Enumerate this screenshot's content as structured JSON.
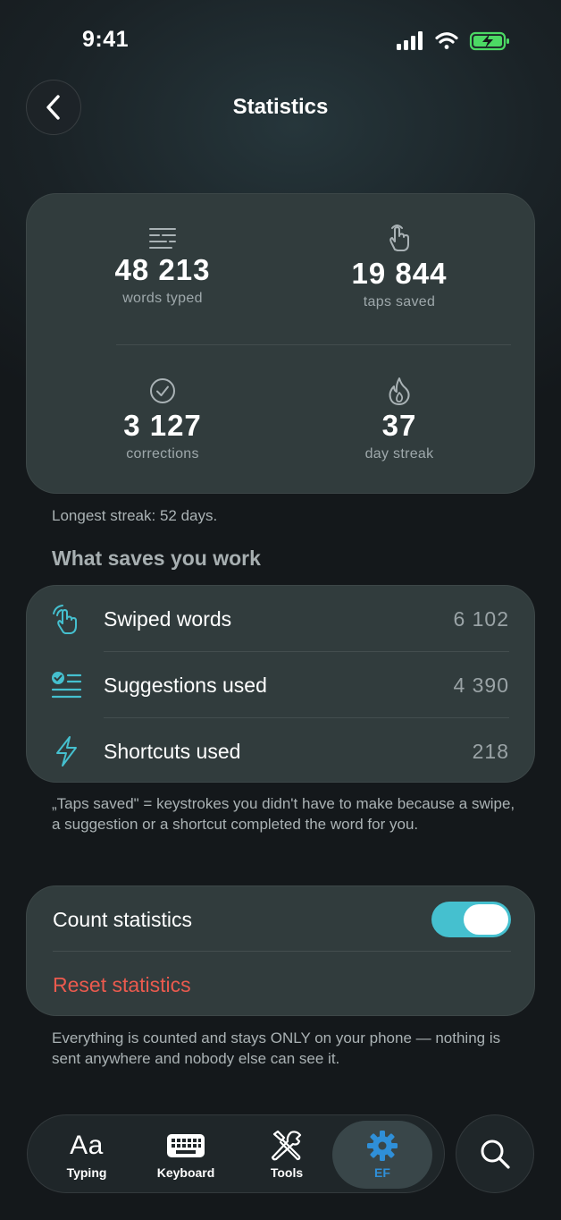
{
  "status_bar": {
    "time": "9:41"
  },
  "nav": {
    "title": "Statistics"
  },
  "stats": {
    "words_typed": {
      "value": "48 213",
      "label": "words typed"
    },
    "taps_saved": {
      "value": "19 844",
      "label": "taps saved"
    },
    "corrections": {
      "value": "3 127",
      "label": "corrections"
    },
    "day_streak": {
      "value": "37",
      "label": "day streak"
    }
  },
  "longest_streak": "Longest streak: 52 days.",
  "work_section": {
    "heading": "What saves you work",
    "items": [
      {
        "label": "Swiped words",
        "value": "6 102",
        "icon": "swipe-hand-icon"
      },
      {
        "label": "Suggestions used",
        "value": "4 390",
        "icon": "suggestions-list-icon"
      },
      {
        "label": "Shortcuts used",
        "value": "218",
        "icon": "lightning-icon"
      }
    ],
    "note": "„Taps saved\" = keystrokes you didn't have to make because a swipe, a suggestion or a shortcut completed the word for you."
  },
  "settings": {
    "count_statistics_label": "Count statistics",
    "count_statistics_on": true,
    "reset_label": "Reset statistics",
    "privacy_note": "Everything is counted and stays ONLY on your phone — nothing is sent anywhere and nobody else can see it."
  },
  "tab_bar": {
    "tabs": [
      {
        "label": "Typing",
        "glyph": "Aa",
        "icon": "typing-icon"
      },
      {
        "label": "Keyboard",
        "icon": "keyboard-icon"
      },
      {
        "label": "Tools",
        "icon": "tools-icon"
      },
      {
        "label": "EF",
        "icon": "gear-icon",
        "active": true
      }
    ]
  },
  "colors": {
    "accent_teal": "#45c0cf",
    "accent_blue": "#2f8fd8",
    "destructive": "#ea5a4e",
    "battery_green": "#4cd964"
  }
}
